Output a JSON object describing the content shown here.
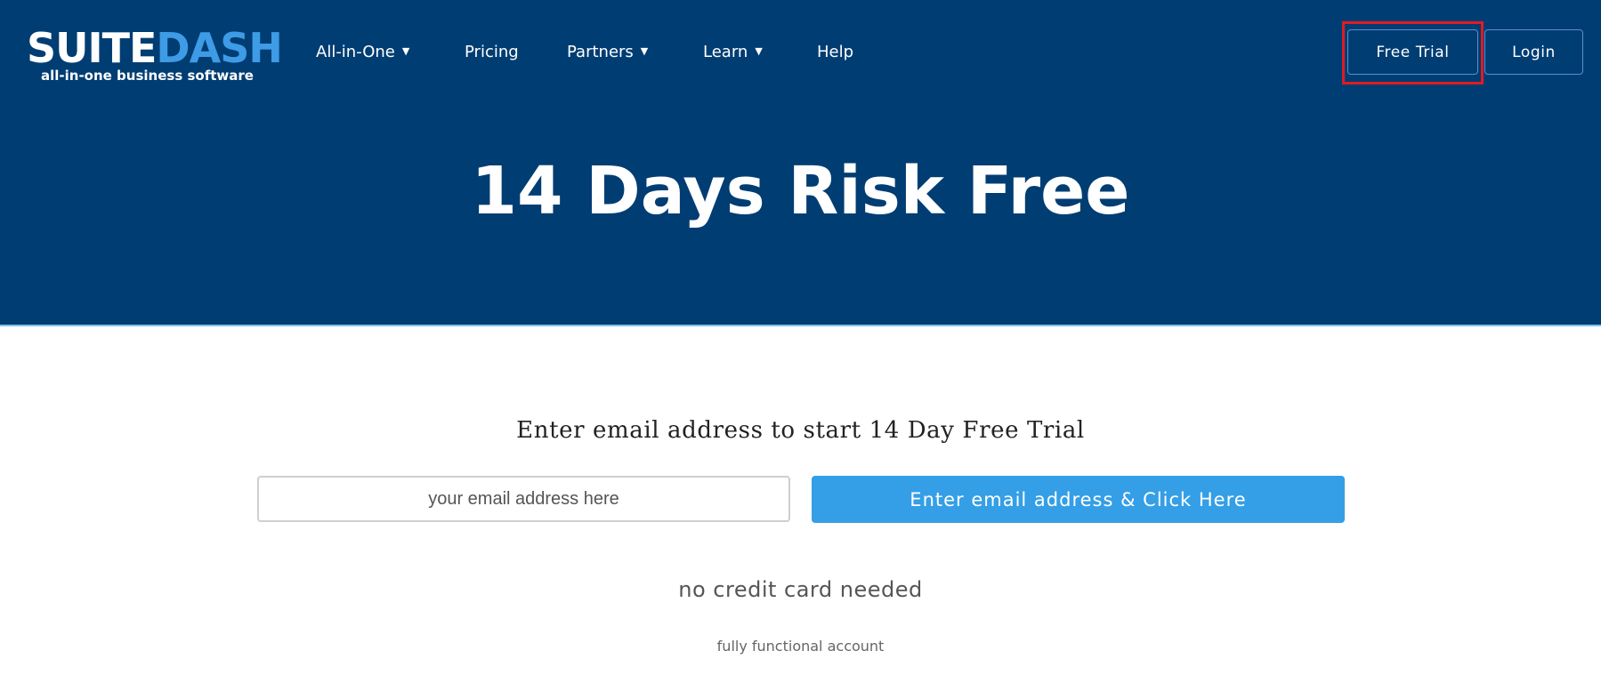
{
  "logo": {
    "word_part1": "SUITE",
    "word_part2": "DASH",
    "tagline": "all-in-one business software"
  },
  "nav": {
    "items": [
      {
        "label": "All-in-One",
        "has_dropdown": true
      },
      {
        "label": "Pricing",
        "has_dropdown": false
      },
      {
        "label": "Partners",
        "has_dropdown": true
      },
      {
        "label": "Learn",
        "has_dropdown": true
      },
      {
        "label": "Help",
        "has_dropdown": false
      }
    ],
    "caret_glyph": "▼"
  },
  "header_buttons": {
    "free_trial": "Free Trial",
    "login": "Login"
  },
  "hero": {
    "title": "14 Days Risk Free"
  },
  "signup": {
    "prompt": "Enter email address to start 14 Day Free Trial",
    "email_placeholder": "your email address here",
    "submit_label": "Enter email address & Click Here",
    "no_credit_card": "no credit card needed",
    "fully_functional": "fully functional account"
  },
  "colors": {
    "hero_background": "#003d73",
    "accent_blue": "#349fe6",
    "logo_dash": "#3e9be6",
    "highlight_red": "#e01b22"
  }
}
